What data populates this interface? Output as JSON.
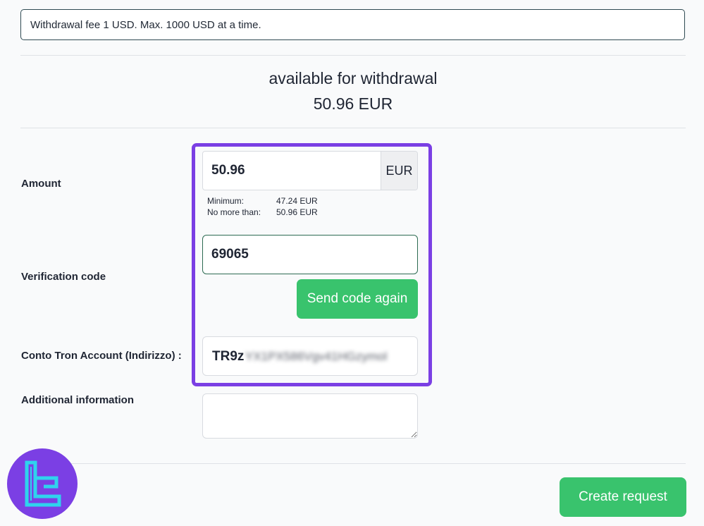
{
  "notice": {
    "text": "Withdrawal fee 1 USD. Max. 1000 USD at a time."
  },
  "availability": {
    "label": "available for withdrawal",
    "value": "50.96 EUR"
  },
  "amount": {
    "label": "Amount",
    "value": "50.96",
    "currency": "EUR",
    "min_label": "Minimum:",
    "min_value": "47.24 EUR",
    "max_label": "No more than:",
    "max_value": "50.96 EUR"
  },
  "verification": {
    "label": "Verification code",
    "value": "69065",
    "send_button": "Send code again"
  },
  "account": {
    "label": "Conto Tron Account (Indirizzo) :",
    "visible_prefix": "TR9z",
    "blurred_rest": "YX1PX586Vgv41HGzymol"
  },
  "additional": {
    "label": "Additional information",
    "value": ""
  },
  "actions": {
    "create_button": "Create request"
  },
  "colors": {
    "accent_green": "#39c36d",
    "highlight_purple": "#7b3fe4",
    "logo_cyan": "#2fd3ee"
  },
  "icons": {
    "logo": "tradingfinder-tf-logo"
  }
}
